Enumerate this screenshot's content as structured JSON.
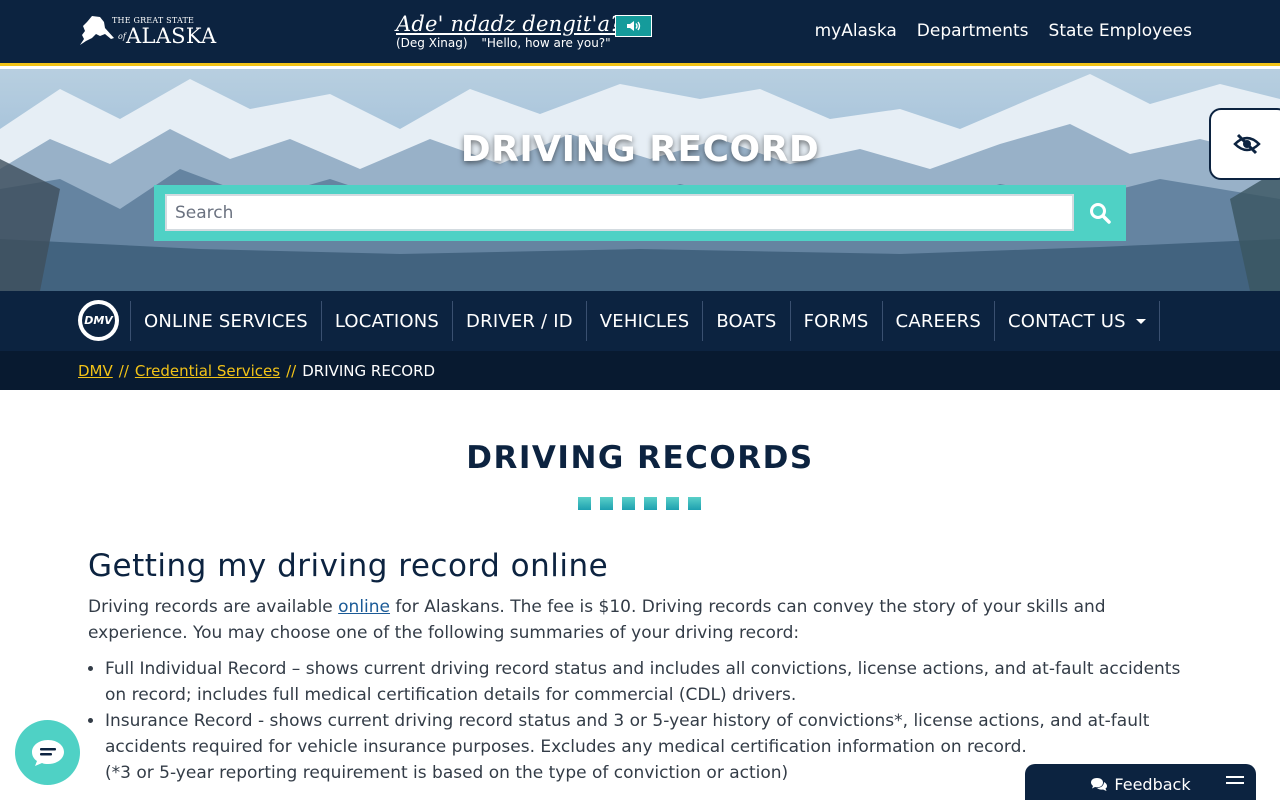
{
  "header": {
    "logo": {
      "great_state": "THE GREAT STATE",
      "of": "of",
      "state": "ALASKA"
    },
    "greeting": {
      "native": "Ade' ndadz dengit'a?",
      "language": "(Deg Xinag)",
      "translation": "\"Hello, how are you?\""
    },
    "links": [
      "myAlaska",
      "Departments",
      "State Employees"
    ]
  },
  "hero": {
    "title": "DRIVING RECORD",
    "search_placeholder": "Search"
  },
  "nav": {
    "badge": "DMV",
    "items": [
      "ONLINE SERVICES",
      "LOCATIONS",
      "DRIVER / ID",
      "VEHICLES",
      "BOATS",
      "FORMS",
      "CAREERS",
      "CONTACT US"
    ]
  },
  "breadcrumb": {
    "items": [
      "DMV",
      "Credential Services"
    ],
    "separator": "//",
    "current": "DRIVING RECORD"
  },
  "main": {
    "title": "DRIVING RECORDS",
    "section_heading": "Getting my driving record online",
    "intro_before": "Driving records are available ",
    "intro_link": "online",
    "intro_after": " for Alaskans. The fee is $10. Driving records can convey the story of your skills and experience. You may choose one of the following summaries of your driving record:",
    "list": [
      "Full Individual Record – shows current driving record status and includes all convictions, license actions, and at-fault accidents on record; includes full medical certification details for commercial (CDL) drivers.",
      "Insurance Record - shows current driving record status and 3 or 5-year history of convictions*, license actions, and at-fault accidents required for vehicle insurance purposes. Excludes any medical certification information on record.",
      "(*3 or 5-year reporting requirement is based on the type of conviction or action)"
    ]
  },
  "widgets": {
    "feedback_label": "Feedback"
  },
  "colors": {
    "navy": "#0c2340",
    "gold": "#f2c318",
    "teal": "#4fd1c5"
  }
}
